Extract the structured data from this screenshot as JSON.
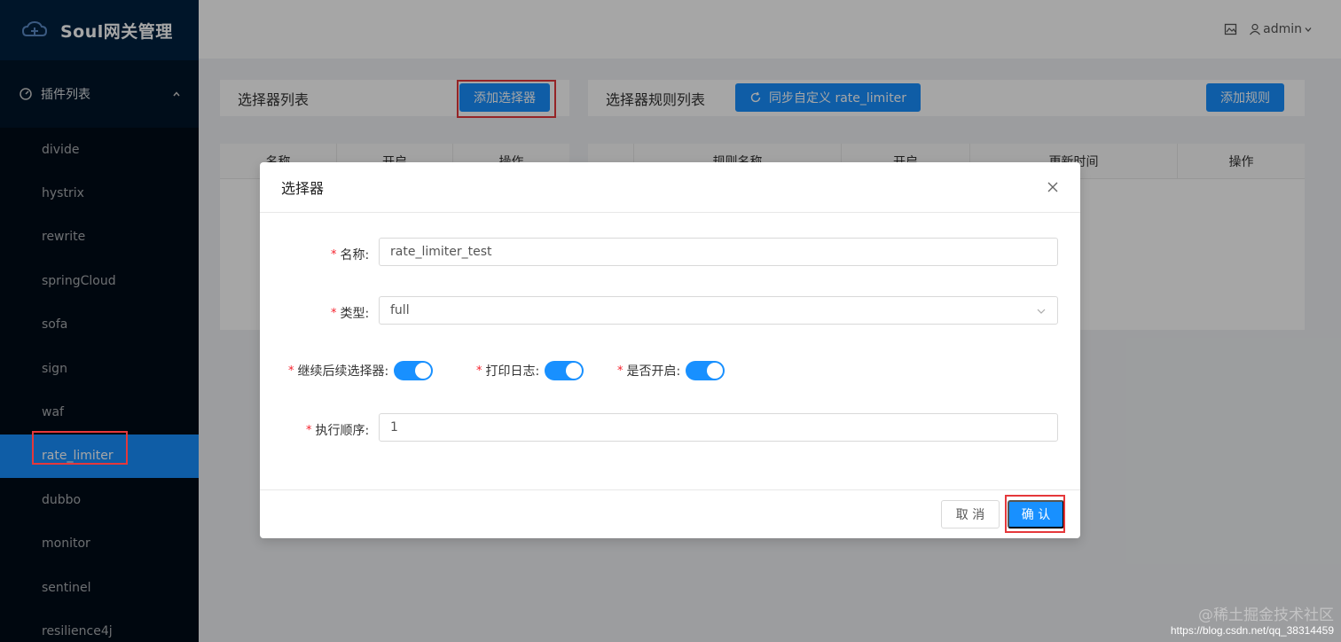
{
  "brand": {
    "title": "Soul网关管理"
  },
  "sidebar": {
    "group_label": "插件列表",
    "items": [
      {
        "label": "divide"
      },
      {
        "label": "hystrix"
      },
      {
        "label": "rewrite"
      },
      {
        "label": "springCloud"
      },
      {
        "label": "sofa"
      },
      {
        "label": "sign"
      },
      {
        "label": "waf"
      },
      {
        "label": "rate_limiter",
        "active": true
      },
      {
        "label": "dubbo"
      },
      {
        "label": "monitor"
      },
      {
        "label": "sentinel"
      },
      {
        "label": "resilience4j"
      }
    ]
  },
  "header": {
    "user": "admin"
  },
  "selector_panel": {
    "title": "选择器列表",
    "add_button": "添加选择器",
    "columns": [
      "名称",
      "开启",
      "操作"
    ]
  },
  "rule_panel": {
    "title": "选择器规则列表",
    "sync_button": "同步自定义 rate_limiter",
    "add_button": "添加规则",
    "columns": [
      "",
      "规则名称",
      "开启",
      "更新时间",
      "操作"
    ]
  },
  "modal": {
    "title": "选择器",
    "fields": {
      "name_label": "名称:",
      "name_value": "rate_limiter_test",
      "type_label": "类型:",
      "type_value": "full",
      "continued_label": "继续后续选择器:",
      "log_label": "打印日志:",
      "enabled_label": "是否开启:",
      "order_label": "执行顺序:",
      "order_value": "1"
    },
    "switches": {
      "continued": true,
      "log": true,
      "enabled": true
    },
    "cancel": "取 消",
    "ok": "确 认"
  },
  "watermark": {
    "line1": "@稀土掘金技术社区",
    "line2": "https://blog.csdn.net/qq_38314459"
  },
  "colors": {
    "primary": "#1890ff",
    "sidebar_bg": "#001529",
    "highlight": "#e5383b"
  }
}
